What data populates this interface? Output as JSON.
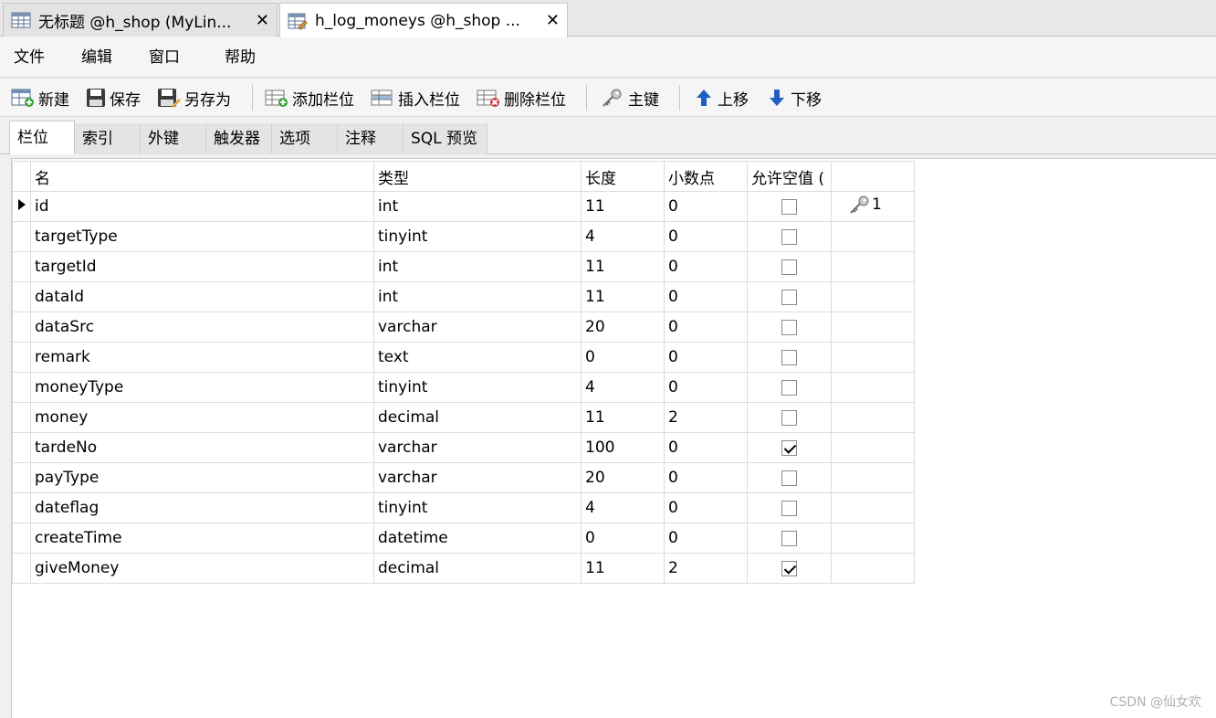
{
  "doc_tabs": [
    {
      "label": "无标题 @h_shop (MyLin...",
      "active": false
    },
    {
      "label": "h_log_moneys @h_shop ...",
      "active": true
    }
  ],
  "close_glyph": "✕",
  "menu": [
    "文件",
    "编辑",
    "窗口",
    "帮助"
  ],
  "toolbar": {
    "new": "新建",
    "save": "保存",
    "save_as": "另存为",
    "add_field": "添加栏位",
    "insert_field": "插入栏位",
    "delete_field": "删除栏位",
    "primary_key": "主键",
    "move_up": "上移",
    "move_down": "下移"
  },
  "subtabs": [
    "栏位",
    "索引",
    "外键",
    "触发器",
    "选项",
    "注释",
    "SQL 预览"
  ],
  "grid": {
    "headers": [
      "名",
      "类型",
      "长度",
      "小数点",
      "允许空值 (",
      ""
    ],
    "rows": [
      {
        "name": "id",
        "type": "int",
        "length": "11",
        "decimals": "0",
        "nullable": false,
        "key": "1"
      },
      {
        "name": "targetType",
        "type": "tinyint",
        "length": "4",
        "decimals": "0",
        "nullable": false,
        "key": ""
      },
      {
        "name": "targetId",
        "type": "int",
        "length": "11",
        "decimals": "0",
        "nullable": false,
        "key": ""
      },
      {
        "name": "dataId",
        "type": "int",
        "length": "11",
        "decimals": "0",
        "nullable": false,
        "key": ""
      },
      {
        "name": "dataSrc",
        "type": "varchar",
        "length": "20",
        "decimals": "0",
        "nullable": false,
        "key": ""
      },
      {
        "name": "remark",
        "type": "text",
        "length": "0",
        "decimals": "0",
        "nullable": false,
        "key": ""
      },
      {
        "name": "moneyType",
        "type": "tinyint",
        "length": "4",
        "decimals": "0",
        "nullable": false,
        "key": ""
      },
      {
        "name": "money",
        "type": "decimal",
        "length": "11",
        "decimals": "2",
        "nullable": false,
        "key": ""
      },
      {
        "name": "tardeNo",
        "type": "varchar",
        "length": "100",
        "decimals": "0",
        "nullable": true,
        "key": ""
      },
      {
        "name": "payType",
        "type": "varchar",
        "length": "20",
        "decimals": "0",
        "nullable": false,
        "key": ""
      },
      {
        "name": "dateflag",
        "type": "tinyint",
        "length": "4",
        "decimals": "0",
        "nullable": false,
        "key": ""
      },
      {
        "name": "createTime",
        "type": "datetime",
        "length": "0",
        "decimals": "0",
        "nullable": false,
        "key": ""
      },
      {
        "name": "giveMoney",
        "type": "decimal",
        "length": "11",
        "decimals": "2",
        "nullable": true,
        "key": ""
      }
    ],
    "current_row": 0
  },
  "watermark": "CSDN @仙女欢",
  "icons": {
    "doc_tab_0": "table-grid-icon",
    "doc_tab_1": "table-design-icon",
    "new": "new-table-icon",
    "save": "floppy-disk-icon",
    "save_as": "floppy-disk-pencil-icon",
    "add_field": "add-row-icon",
    "insert_field": "insert-row-icon",
    "delete_field": "delete-row-icon",
    "primary_key": "key-icon",
    "move_up": "arrow-up-icon",
    "move_down": "arrow-down-icon",
    "row_indicator": "triangle-right-icon"
  },
  "colors": {
    "arrow_blue": "#1f5fbf",
    "window_bg": "#f0f0f0"
  }
}
